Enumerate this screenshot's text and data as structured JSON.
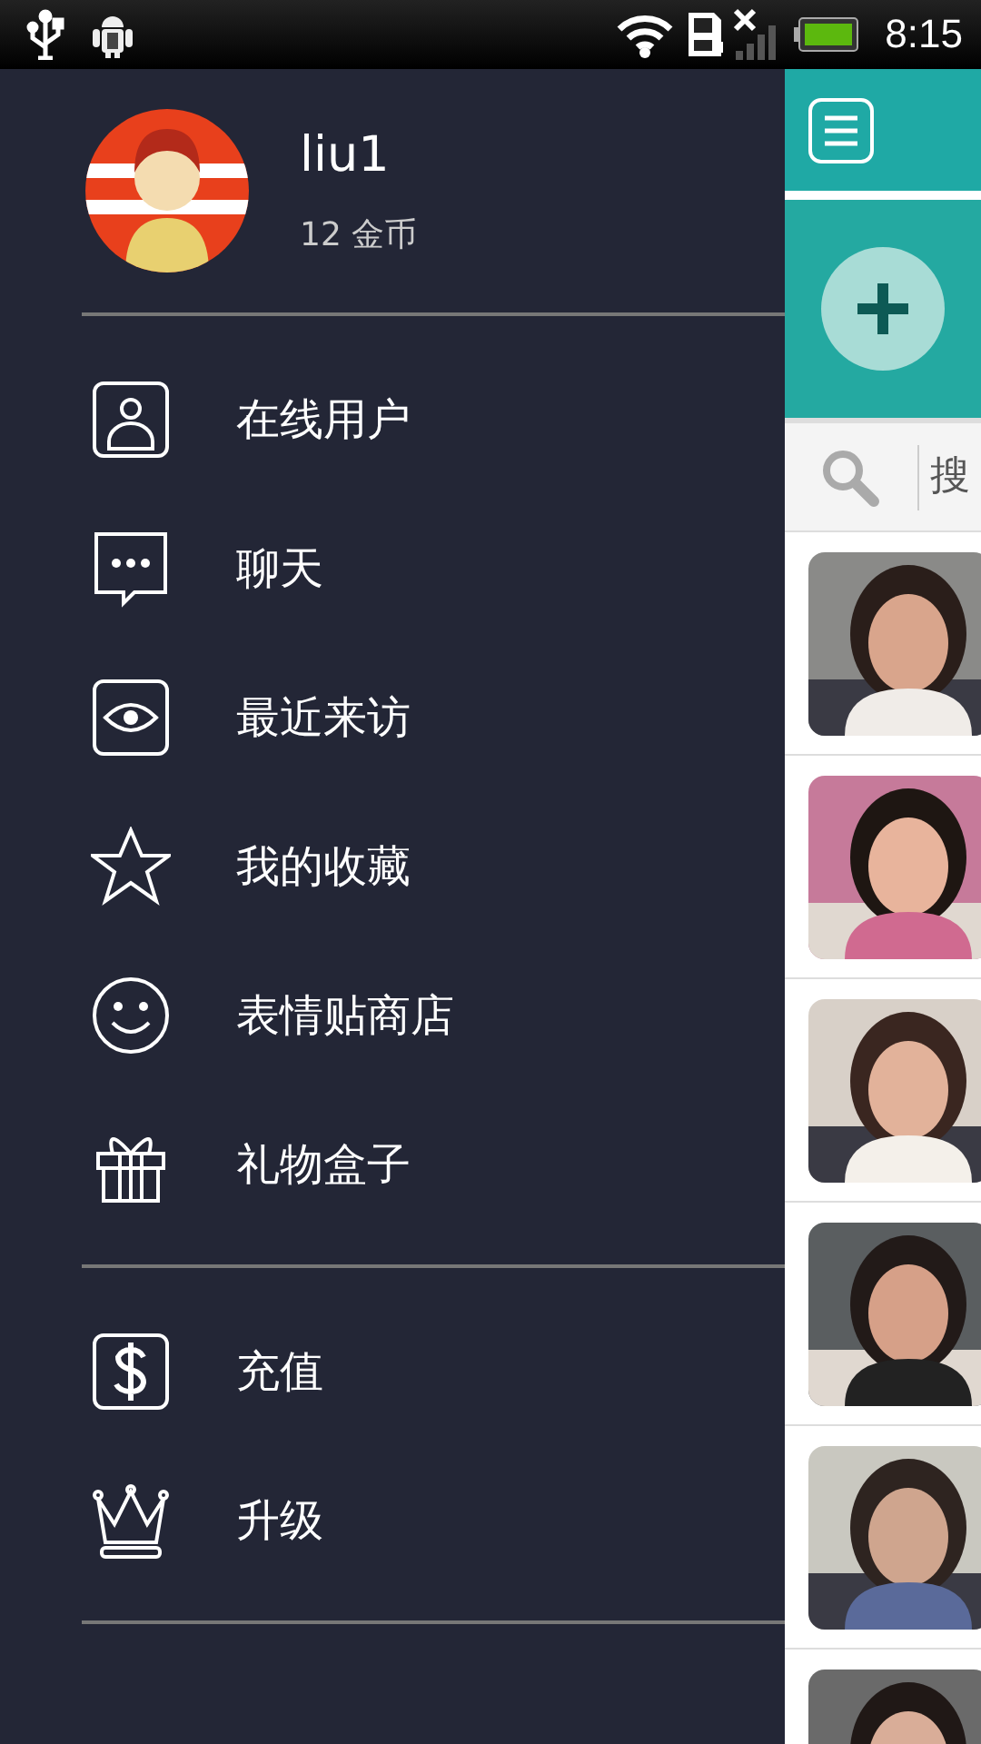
{
  "status_bar": {
    "time": "8:15"
  },
  "profile": {
    "name": "liu1",
    "coins": "12 金币"
  },
  "menu_sections": [
    {
      "items": [
        {
          "label": "在线用户"
        },
        {
          "label": "聊天"
        },
        {
          "label": "最近来访"
        },
        {
          "label": "我的收藏"
        },
        {
          "label": "表情贴商店"
        },
        {
          "label": "礼物盒子"
        }
      ]
    },
    {
      "items": [
        {
          "label": "充值"
        },
        {
          "label": "升级"
        }
      ]
    }
  ],
  "main": {
    "search": {
      "placeholder": "搜"
    }
  }
}
